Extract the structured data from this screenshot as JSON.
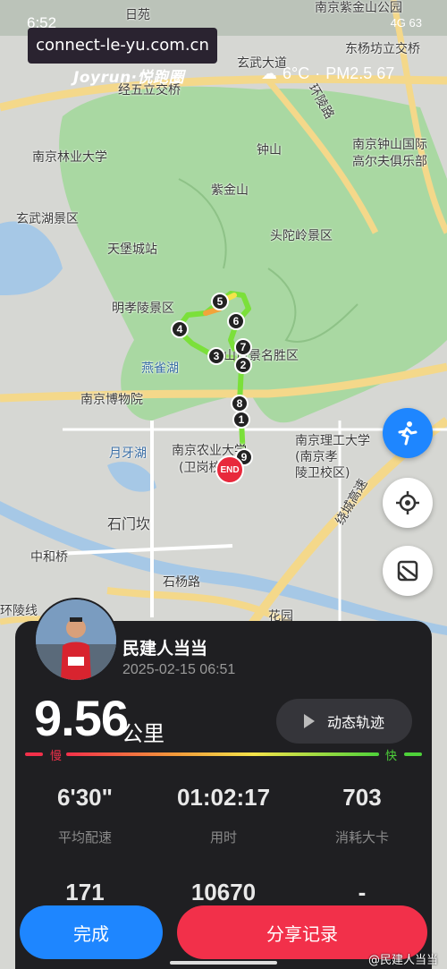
{
  "status_bar": {
    "time": "6:52",
    "right": "4G  63"
  },
  "url_overlay": "connect-le-yu.com.cn",
  "brand": "Joyrun·悦跑圈",
  "weather": {
    "temperature": "6°C",
    "separator": "·",
    "air_quality": "PM2.5 67"
  },
  "map_labels": {
    "l1": "日苑",
    "l2": "南京紫金山公园",
    "l3": "玄武大道",
    "l4": "东杨坊立交桥",
    "l5": "经五立交桥",
    "l6": "环陵路",
    "l7": "钟山",
    "l8": "南京林业大学",
    "l9": "南京钟山国际",
    "l10": "高尔夫俱乐部",
    "l11": "紫金山",
    "l12": "玄武湖景区",
    "l13": "头陀岭景区",
    "l14": "天堡城站",
    "l15": "明孝陵景区",
    "l16": "钟山风景名胜区",
    "l17": "燕雀湖",
    "l18": "南京博物院",
    "l19": "月牙湖",
    "l20": "南京农业大学",
    "l21": "(卫岗校区)",
    "l22": "南京理工大学",
    "l23": "(南京孝",
    "l24": "陵卫校区)",
    "l25": "石门坎",
    "l26": "中和桥",
    "l27": "石杨路",
    "l28": "环陵线",
    "l29": "花园",
    "l30": "绕城高速"
  },
  "route_markers": [
    "1",
    "2",
    "3",
    "4",
    "5",
    "6",
    "7",
    "8",
    "9"
  ],
  "end_marker": "END",
  "user": {
    "name": "民建人当当",
    "datetime": "2025-02-15 06:51"
  },
  "run": {
    "distance": "9.56",
    "unit": "公里"
  },
  "replay_label": "动态轨迹",
  "speed_scale": {
    "slow": "慢",
    "fast": "快"
  },
  "stats": [
    {
      "value": "6'30\"",
      "label": "平均配速"
    },
    {
      "value": "01:02:17",
      "label": "用时"
    },
    {
      "value": "703",
      "label": "消耗大卡"
    },
    {
      "value": "171",
      "label": ""
    },
    {
      "value": "10670",
      "label": ""
    },
    {
      "value": "-",
      "label": ""
    }
  ],
  "buttons": {
    "done": "完成",
    "share": "分享记录"
  },
  "watermark": "@民建人当当",
  "colors": {
    "accent_blue": "#1e86ff",
    "share_red": "#f2304a",
    "route_green": "#7be03a",
    "park_green": "#a8d9a0"
  }
}
